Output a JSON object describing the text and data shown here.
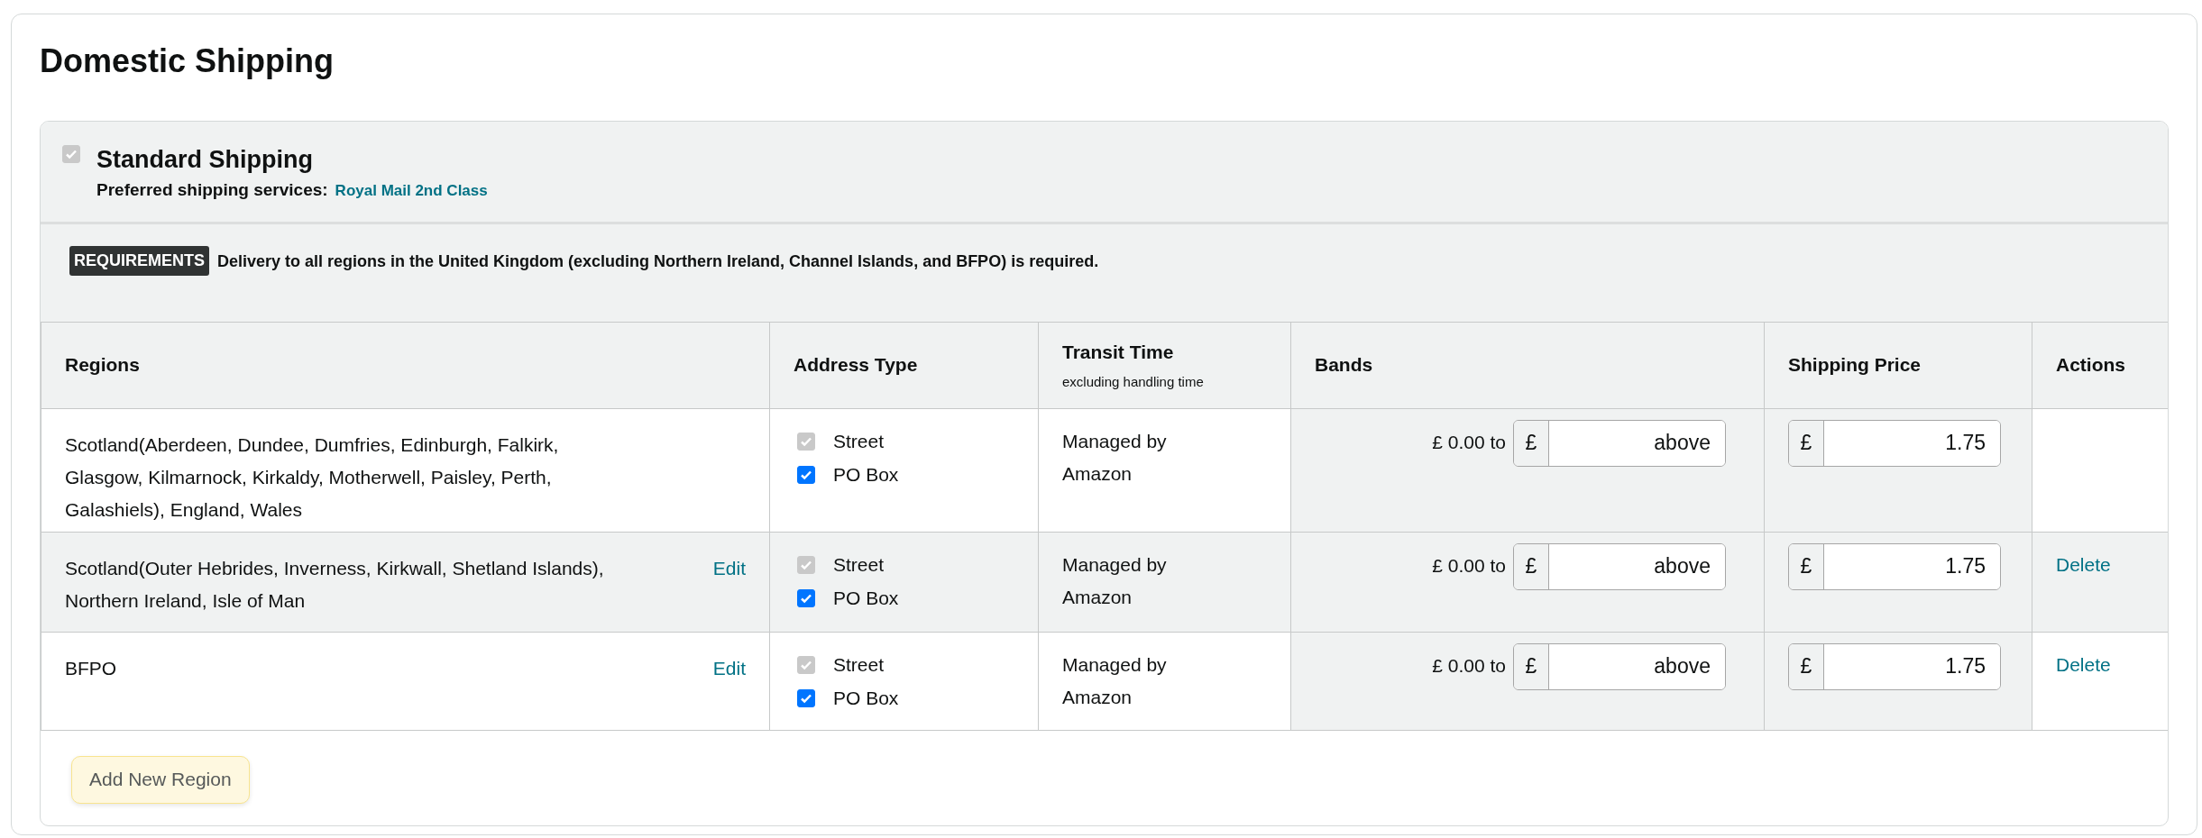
{
  "title": "Domestic Shipping",
  "service": {
    "name": "Standard Shipping",
    "checked": true,
    "disabled": true,
    "preferred_label": "Preferred shipping services:",
    "preferred_link": "Royal Mail 2nd Class"
  },
  "requirements": {
    "badge": "REQUIREMENTS",
    "text": "Delivery to all regions in the United Kingdom (excluding Northern Ireland, Channel Islands, and BFPO) is required."
  },
  "table": {
    "columns": [
      {
        "label": "Regions"
      },
      {
        "label": "Address Type"
      },
      {
        "label": "Transit Time",
        "note": "excluding handling time"
      },
      {
        "label": "Bands"
      },
      {
        "label": "Shipping Price"
      },
      {
        "label": "Actions"
      }
    ],
    "rows": [
      {
        "region": "Scotland(Aberdeen, Dundee, Dumfries, Edinburgh, Falkirk, Glasgow, Kilmarnock, Kirkaldy, Motherwell, Paisley, Perth, Galashiels), England, Wales",
        "shaded": false,
        "address_types": [
          {
            "label": "Street",
            "checked": true,
            "disabled": true
          },
          {
            "label": "PO Box",
            "checked": true,
            "disabled": false
          }
        ],
        "transit": "Managed by Amazon",
        "band": {
          "from": "£ 0.00 to",
          "currency": "£",
          "value": "above"
        },
        "price": {
          "currency": "£",
          "value": "1.75"
        }
      },
      {
        "region": "Scotland(Outer Hebrides, Inverness, Kirkwall, Shetland Islands), Northern Ireland, Isle of Man",
        "edit": "Edit",
        "shaded": true,
        "address_types": [
          {
            "label": "Street",
            "checked": true,
            "disabled": true
          },
          {
            "label": "PO Box",
            "checked": true,
            "disabled": false
          }
        ],
        "transit": "Managed by Amazon",
        "band": {
          "from": "£ 0.00 to",
          "currency": "£",
          "value": "above"
        },
        "price": {
          "currency": "£",
          "value": "1.75"
        },
        "delete": "Delete"
      },
      {
        "region": "BFPO",
        "edit": "Edit",
        "shaded": false,
        "address_types": [
          {
            "label": "Street",
            "checked": true,
            "disabled": true
          },
          {
            "label": "PO Box",
            "checked": true,
            "disabled": false
          }
        ],
        "transit": "Managed by Amazon",
        "band": {
          "from": "£ 0.00 to",
          "currency": "£",
          "value": "above"
        },
        "price": {
          "currency": "£",
          "value": "1.75"
        },
        "delete": "Delete"
      }
    ]
  },
  "add_button": "Add New Region"
}
